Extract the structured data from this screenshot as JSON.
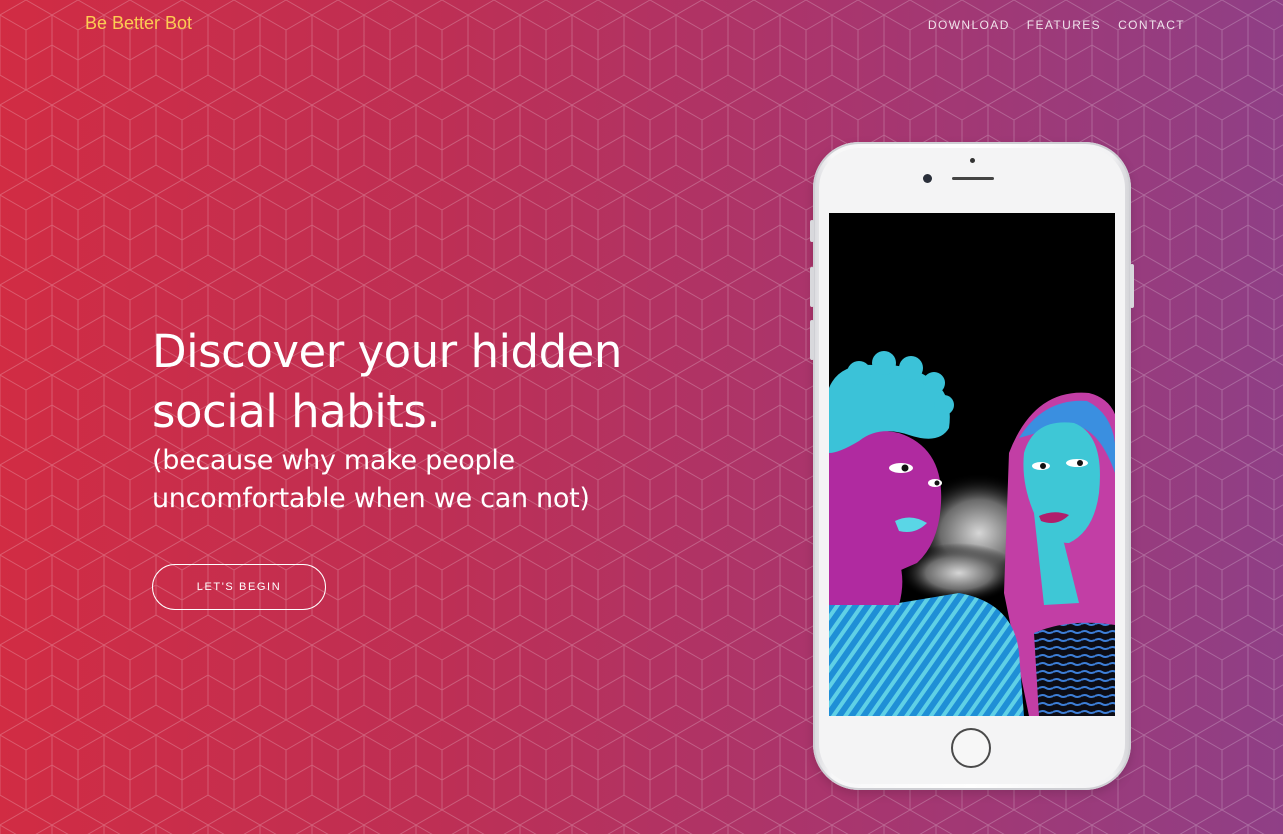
{
  "navbar": {
    "brand": "Be Better Bot",
    "links": [
      "DOWNLOAD",
      "FEATURES",
      "CONTACT"
    ]
  },
  "hero": {
    "headline_line1": "Discover your hidden",
    "headline_line2": "social habits.",
    "subhead_line1": "(because why make people",
    "subhead_line2": "uncomfortable when we can not)",
    "cta_label": "LET'S BEGIN"
  },
  "colors": {
    "brand": "#fdcc52",
    "gradient_start": "#d12c43",
    "gradient_end": "#8f3f86"
  },
  "device": {
    "type": "smartphone",
    "screen_illustration": "two people illustration in magenta and cyan on black background"
  }
}
